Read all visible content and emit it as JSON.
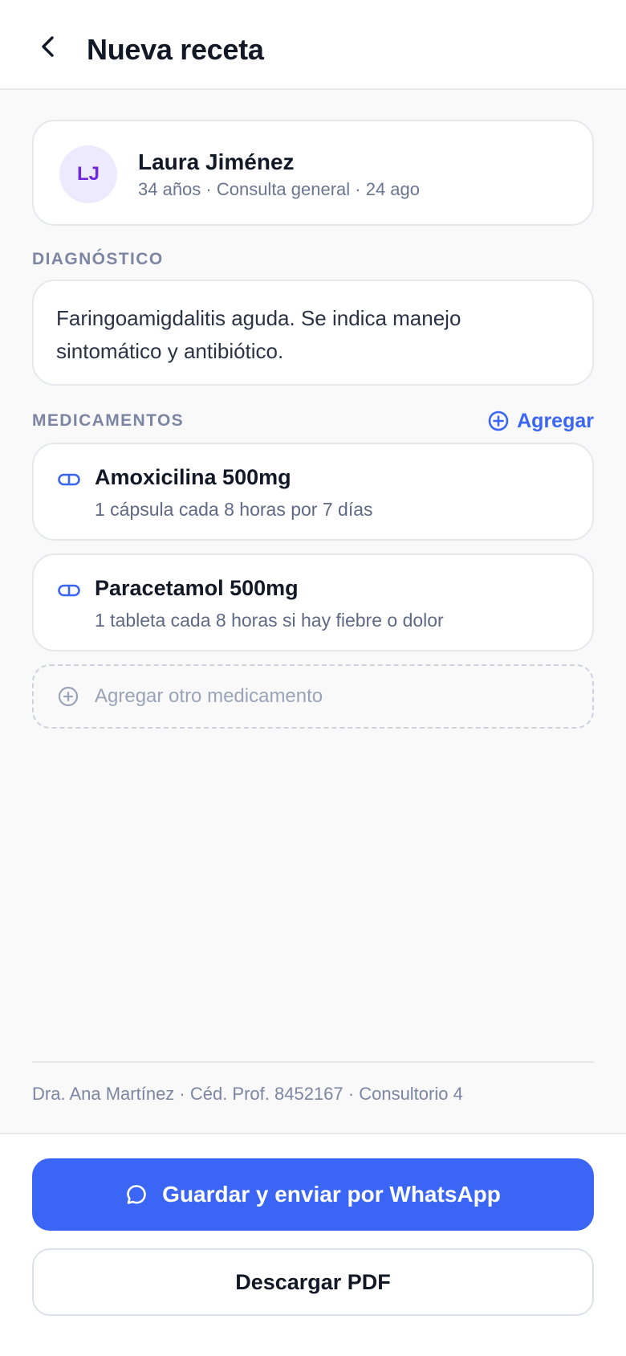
{
  "header": {
    "title": "Nueva receta",
    "back_icon": "chevron-left-icon"
  },
  "patient": {
    "initials": "LJ",
    "name": "Laura Jiménez",
    "meta": "34 años · Consulta general · 24 ago"
  },
  "diagnosis": {
    "label": "DIAGNÓSTICO",
    "text": "Faringoamigdalitis aguda. Se indica manejo sintomático y antibiótico."
  },
  "medications": {
    "label": "MEDICAMENTOS",
    "add_label": "Agregar",
    "items": [
      {
        "name": "Amoxicilina 500mg",
        "dose": "1 cápsula cada 8 horas por 7 días",
        "icon": "pill-icon"
      },
      {
        "name": "Paracetamol 500mg",
        "dose": "1 tableta cada 8 horas si hay fiebre o dolor",
        "icon": "pill-icon"
      }
    ],
    "add_other_label": "Agregar otro medicamento"
  },
  "doctor": {
    "info": "Dra. Ana Martínez · Céd. Prof. 8452167 · Consultorio 4"
  },
  "actions": {
    "primary_label": "Guardar y enviar por WhatsApp",
    "secondary_label": "Descargar PDF"
  },
  "colors": {
    "accent": "#3b66f5",
    "avatar_bg": "#ede9fe",
    "avatar_text": "#6d28d9"
  }
}
